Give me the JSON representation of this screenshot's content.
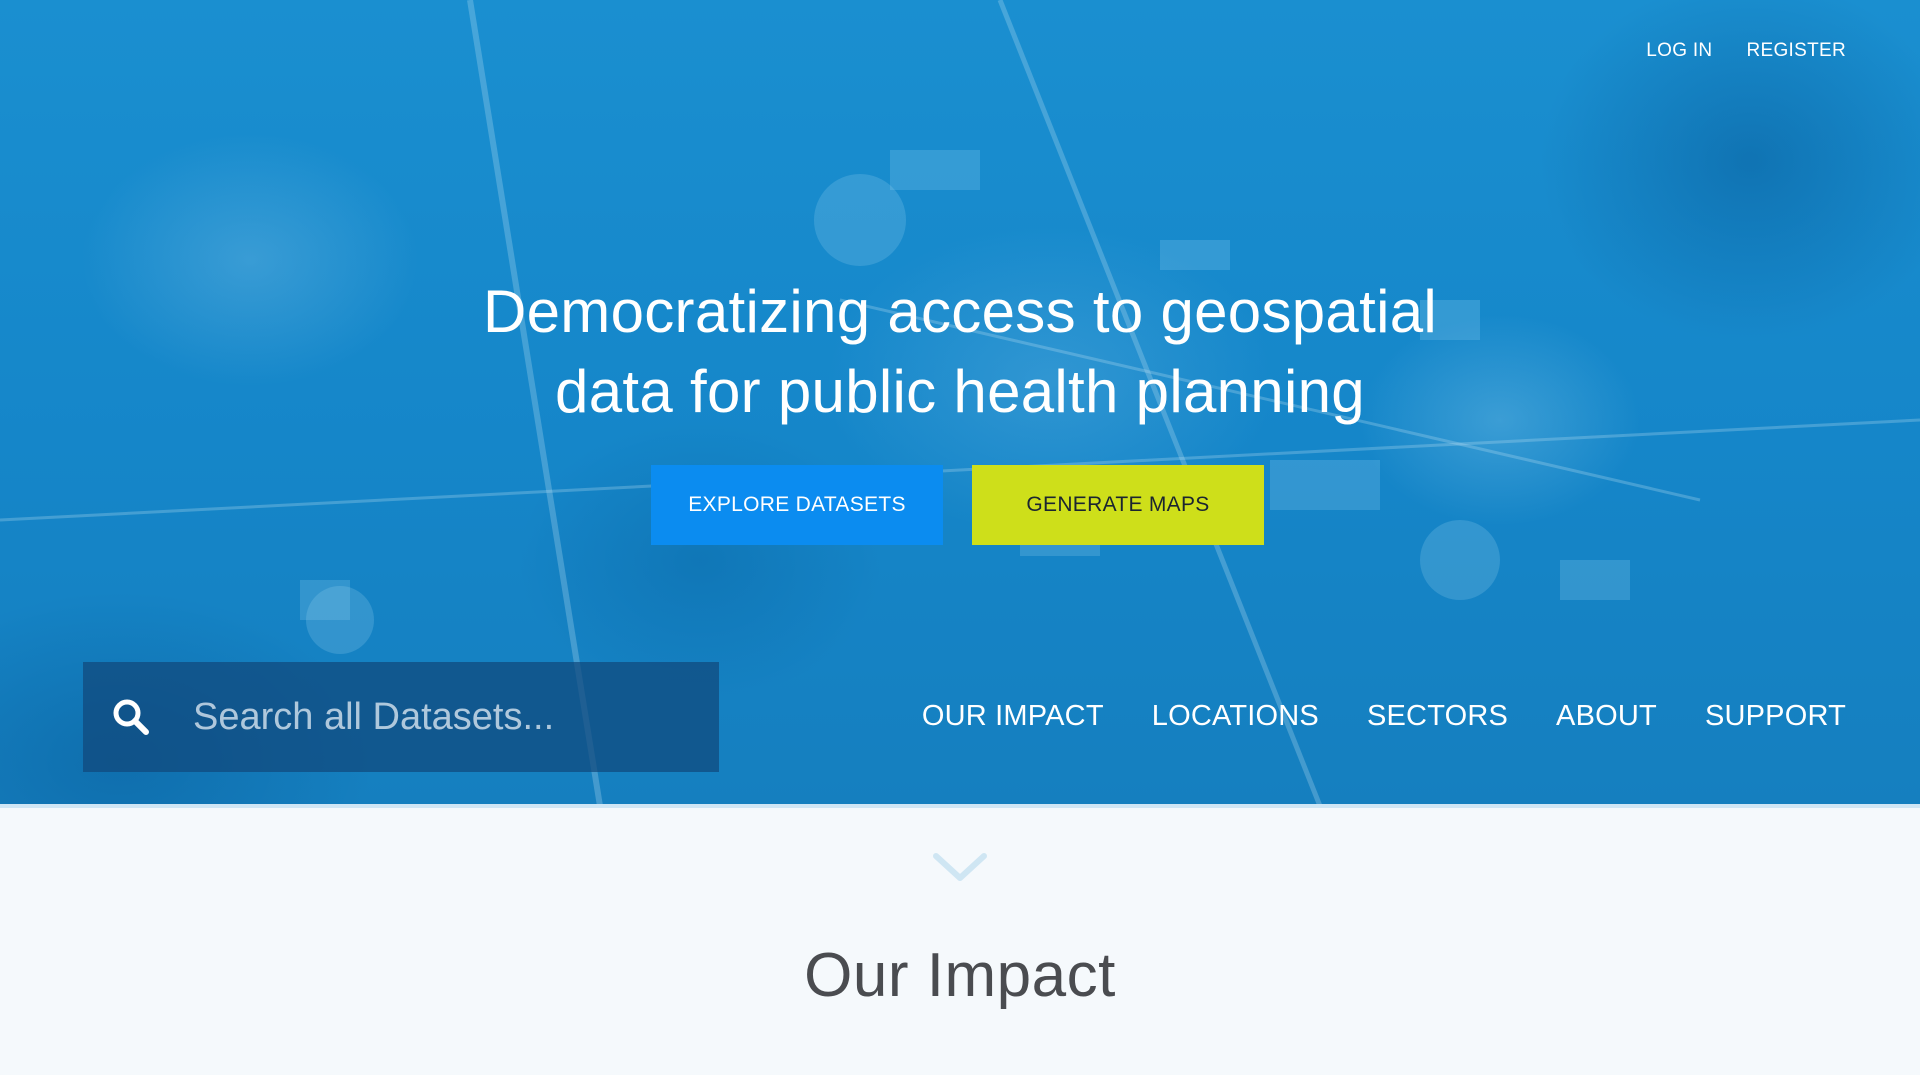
{
  "top_nav": {
    "login": "LOG IN",
    "register": "REGISTER"
  },
  "hero": {
    "headline_line1": "Democratizing access to geospatial",
    "headline_line2": "data for public health planning",
    "explore_button": "EXPLORE DATASETS",
    "generate_button": "GENERATE MAPS"
  },
  "search": {
    "placeholder": "Search all Datasets...",
    "value": "",
    "icon": "search-icon"
  },
  "main_nav": {
    "items": [
      "OUR IMPACT",
      "LOCATIONS",
      "SECTORS",
      "ABOUT",
      "SUPPORT"
    ]
  },
  "scroll_indicator": {
    "icon": "chevron-down-icon"
  },
  "section": {
    "title": "Our Impact"
  },
  "colors": {
    "hero_blue": "#1586c9",
    "explore_button": "#0b8cf0",
    "generate_button": "#cedf1a",
    "page_background": "#f5f9fc",
    "title_text": "#4a4c50"
  }
}
